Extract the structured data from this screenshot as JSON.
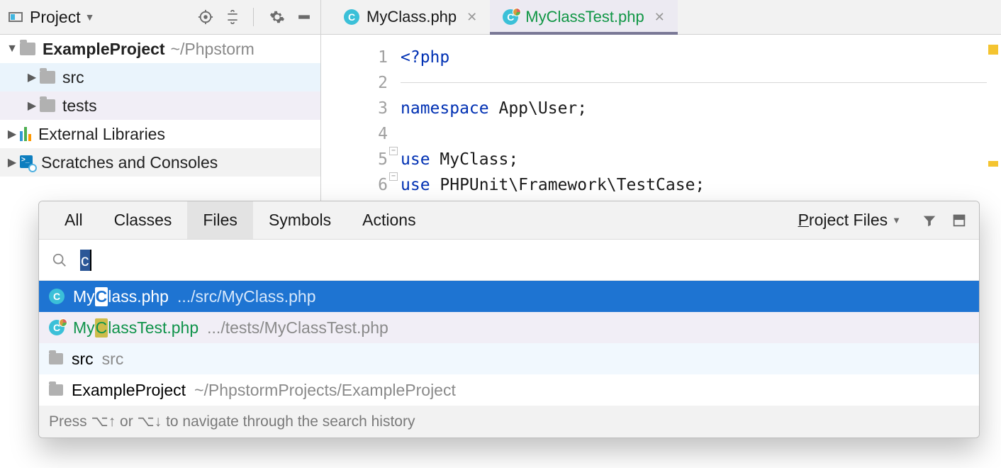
{
  "sidebar": {
    "title": "Project",
    "project": {
      "name": "ExampleProject",
      "path": "~/Phpstorm"
    },
    "folders": {
      "src": "src",
      "tests": "tests"
    },
    "externals": "External Libraries",
    "scratches": "Scratches and Consoles"
  },
  "tabs": {
    "t1": "MyClass.php",
    "t2": "MyClassTest.php"
  },
  "editor": {
    "lines": {
      "l1": "<?php",
      "l3_kw": "namespace ",
      "l3_rest": "App\\User;",
      "l5_kw": "use ",
      "l5_rest": "MyClass;",
      "l6_kw": "use ",
      "l6_rest": "PHPUnit\\Framework\\TestCase;"
    },
    "lineNums": {
      "n1": "1",
      "n2": "2",
      "n3": "3",
      "n4": "4",
      "n5": "5",
      "n6": "6"
    }
  },
  "search": {
    "tabs": {
      "all": "All",
      "classes": "Classes",
      "files": "Files",
      "symbols": "Symbols",
      "actions": "Actions"
    },
    "scopePrefix": "P",
    "scopeRest": "roject Files",
    "query": "c",
    "results": {
      "r1_pre": "My",
      "r1_hl": "C",
      "r1_post": "lass.php",
      "r1_path": ".../src/MyClass.php",
      "r2_pre": "My",
      "r2_hl": "C",
      "r2_post": "lassTest.php",
      "r2_path": ".../tests/MyClassTest.php",
      "r3_name": "src",
      "r3_path": "src",
      "r4_name": "ExampleProject",
      "r4_path": "~/PhpstormProjects/ExampleProject"
    },
    "footer": "Press ⌥↑ or ⌥↓ to navigate through the search history"
  }
}
